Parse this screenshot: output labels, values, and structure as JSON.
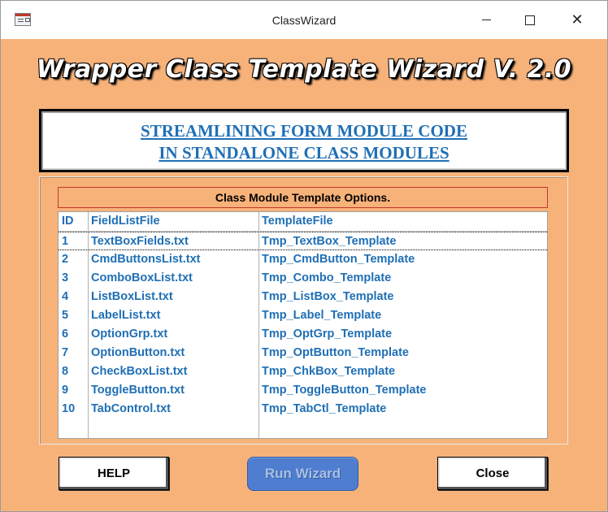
{
  "window": {
    "title": "ClassWizard",
    "controls": {
      "minimize": "minimize",
      "maximize": "maximize",
      "close": "✕"
    }
  },
  "header": {
    "title": "Wrapper Class Template Wizard V. 2.0"
  },
  "banner": {
    "line1": "STREAMLINING FORM MODULE CODE",
    "line2": "IN STANDALONE CLASS MODULES"
  },
  "options": {
    "title": "Class Module Template Options.",
    "columns": {
      "id": "ID",
      "field": "FieldListFile",
      "template": "TemplateFile"
    },
    "rows": [
      {
        "id": "1",
        "field": "TextBoxFields.txt",
        "template": "Tmp_TextBox_Template"
      },
      {
        "id": "2",
        "field": "CmdButtonsList.txt",
        "template": "Tmp_CmdButton_Template"
      },
      {
        "id": "3",
        "field": "ComboBoxList.txt",
        "template": "Tmp_Combo_Template"
      },
      {
        "id": "4",
        "field": "ListBoxList.txt",
        "template": "Tmp_ListBox_Template"
      },
      {
        "id": "5",
        "field": "LabelList.txt",
        "template": "Tmp_Label_Template"
      },
      {
        "id": "6",
        "field": "OptionGrp.txt",
        "template": "Tmp_OptGrp_Template"
      },
      {
        "id": "7",
        "field": "OptionButton.txt",
        "template": "Tmp_OptButton_Template"
      },
      {
        "id": "8",
        "field": "CheckBoxList.txt",
        "template": "Tmp_ChkBox_Template"
      },
      {
        "id": "9",
        "field": "ToggleButton.txt",
        "template": "Tmp_ToggleButton_Template"
      },
      {
        "id": "10",
        "field": "TabControl.txt",
        "template": "Tmp_TabCtl_Template"
      }
    ]
  },
  "buttons": {
    "help": "HELP",
    "run": "Run Wizard",
    "close": "Close"
  },
  "colors": {
    "background": "#f7b27a",
    "accent": "#1f6fb5",
    "run_button": "#4f7ed0"
  }
}
